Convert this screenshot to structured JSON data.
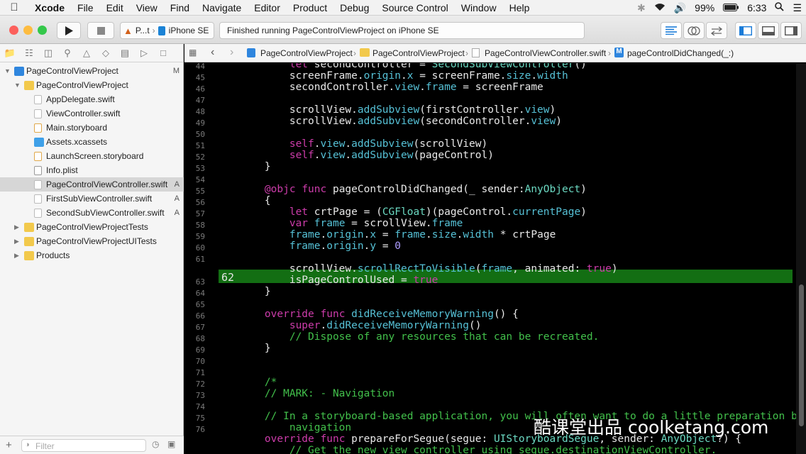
{
  "menubar": {
    "app_name": "Xcode",
    "items": [
      "File",
      "Edit",
      "View",
      "Find",
      "Navigate",
      "Editor",
      "Product",
      "Debug",
      "Source Control",
      "Window",
      "Help"
    ],
    "battery": "99%",
    "clock": "6:33"
  },
  "toolbar": {
    "scheme_name": "P...t",
    "device": "iPhone SE",
    "status_text": "Finished running PageControlViewProject on iPhone SE"
  },
  "navigator": {
    "rows": [
      {
        "label": "PageControlViewProject",
        "badge": "M",
        "kind": "project"
      },
      {
        "label": "PageControlViewProject",
        "badge": "",
        "kind": "folder"
      },
      {
        "label": "AppDelegate.swift",
        "badge": "",
        "kind": "swift"
      },
      {
        "label": "ViewController.swift",
        "badge": "",
        "kind": "swift"
      },
      {
        "label": "Main.storyboard",
        "badge": "",
        "kind": "storyboard"
      },
      {
        "label": "Assets.xcassets",
        "badge": "",
        "kind": "assets"
      },
      {
        "label": "LaunchScreen.storyboard",
        "badge": "",
        "kind": "storyboard"
      },
      {
        "label": "Info.plist",
        "badge": "",
        "kind": "plist"
      },
      {
        "label": "PageControlViewController.swift",
        "badge": "A",
        "kind": "swift"
      },
      {
        "label": "FirstSubViewController.swift",
        "badge": "A",
        "kind": "swift"
      },
      {
        "label": "SecondSubViewController.swift",
        "badge": "A",
        "kind": "swift"
      },
      {
        "label": "PageControlViewProjectTests",
        "badge": "",
        "kind": "folder"
      },
      {
        "label": "PageControlViewProjectUITests",
        "badge": "",
        "kind": "folder"
      },
      {
        "label": "Products",
        "badge": "",
        "kind": "folder"
      }
    ],
    "filter_placeholder": "Filter"
  },
  "jumpbar": {
    "crumbs": [
      "PageControlViewProject",
      "PageControlViewProject",
      "PageControlViewController.swift",
      "pageControlDidChanged(_:)"
    ]
  },
  "editor": {
    "current_line": "62",
    "line_numbers": [
      "44",
      "45",
      "46",
      "47",
      "48",
      "49",
      "50",
      "51",
      "52",
      "53",
      "54",
      "55",
      "56",
      "57",
      "58",
      "59",
      "60",
      "61",
      "62",
      "63",
      "64",
      "65",
      "66",
      "67",
      "68",
      "69",
      "70",
      "71",
      "72",
      "73",
      "74",
      "75",
      "76"
    ],
    "lines": [
      "        let secondController = SecondSubViewController()",
      "        screenFrame.origin.x = screenFrame.size.width",
      "        secondController.view.frame = screenFrame",
      "",
      "        scrollView.addSubview(firstController.view)",
      "        scrollView.addSubview(secondController.view)",
      "",
      "        self.view.addSubview(scrollView)",
      "        self.view.addSubview(pageControl)",
      "    }",
      "",
      "    @objc func pageControlDidChanged(_ sender:AnyObject)",
      "    {",
      "        let crtPage = (CGFloat)(pageControl.currentPage)",
      "        var frame = scrollView.frame",
      "        frame.origin.x = frame.size.width * crtPage",
      "        frame.origin.y = 0",
      "",
      "        scrollView.scrollRectToVisible(frame, animated: true)",
      "        isPageControlUsed = true",
      "    }",
      "",
      "    override func didReceiveMemoryWarning() {",
      "        super.didReceiveMemoryWarning()",
      "        // Dispose of any resources that can be recreated.",
      "    }",
      "",
      "",
      "    /*",
      "    // MARK: - Navigation",
      "",
      "    // In a storyboard-based application, you will often want to do a little preparation before",
      "        navigation",
      "    override func prepareForSegue(segue: UIStoryboardSegue, sender: AnyObject?) {",
      "        // Get the new view controller using segue.destinationViewController."
    ]
  },
  "watermark": "酷课堂出品 coolketang.com"
}
